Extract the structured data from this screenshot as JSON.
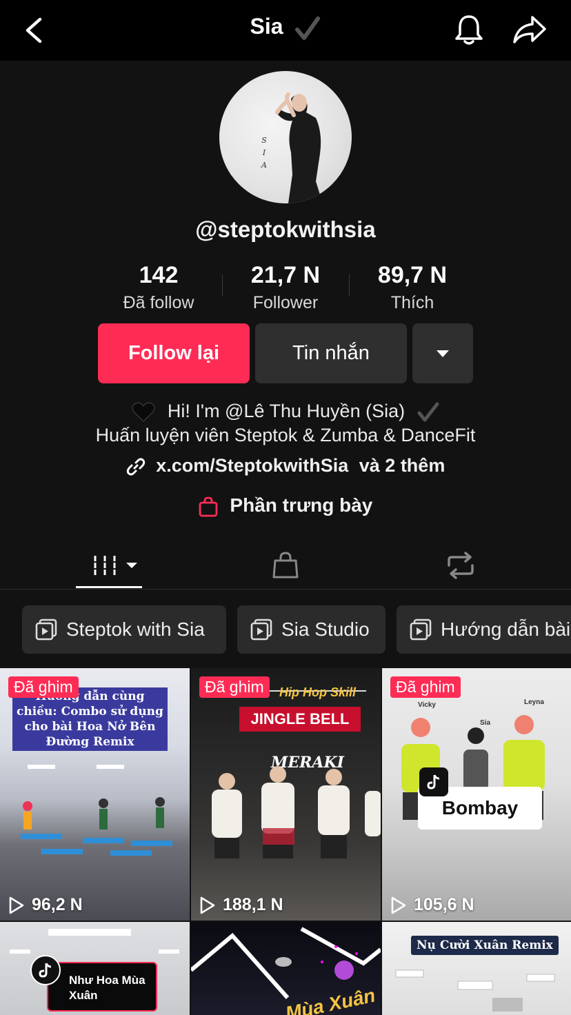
{
  "header": {
    "title": "Sia",
    "verified": true
  },
  "profile": {
    "handle": "@steptokwithsia",
    "avatar_text": "S I A"
  },
  "stats": [
    {
      "value": "142",
      "label": "Đã follow"
    },
    {
      "value": "21,7 N",
      "label": "Follower"
    },
    {
      "value": "89,7 N",
      "label": "Thích"
    }
  ],
  "actions": {
    "follow_label": "Follow lại",
    "message_label": "Tin nhắn"
  },
  "bio": {
    "line1": "Hi! I'm @Lê Thu Huyền (Sia)",
    "line2": "Huấn luyện viên Steptok & Zumba & DanceFit",
    "link": "x.com/SteptokwithSia",
    "link_more": "và 2 thêm",
    "showcase": "Phần trưng bày"
  },
  "playlists": [
    {
      "label": "Steptok with Sia"
    },
    {
      "label": "Sia Studio"
    },
    {
      "label": "Hướng dẫn bài"
    }
  ],
  "videos": [
    {
      "pinned": "Đã ghim",
      "views": "96,2 N",
      "caption": "Hướng dẫn cùng chiều: Combo sử dụng cho bài Hoa Nở Bên Đường Remix"
    },
    {
      "pinned": "Đã ghim",
      "views": "188,1 N",
      "caption_top": "Hip Hop Skill",
      "banner": "JINGLE BELL",
      "studio": "MERAKI"
    },
    {
      "pinned": "Đã ghim",
      "views": "105,6 N",
      "song": "Bombay",
      "names": [
        "Vicky",
        "Sia",
        "Leyna"
      ]
    },
    {
      "caption": "Như Hoa Mùa Xuân"
    },
    {
      "caption": "Mùa Xuân"
    },
    {
      "caption": "Nụ Cười Xuân Remix"
    }
  ],
  "colors": {
    "accent": "#fe2c55",
    "background": "#121212",
    "button_dark": "#2f2f2f"
  }
}
